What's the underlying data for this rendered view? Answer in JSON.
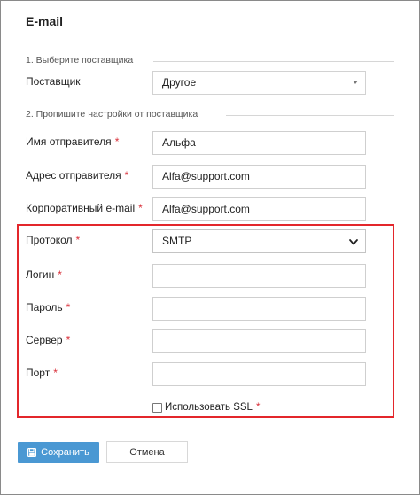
{
  "form": {
    "title": "E-mail",
    "section1": "1. Выберите поставщика",
    "section2": "2. Пропишите настройки от поставщика",
    "required_mark": "*"
  },
  "provider": {
    "label": "Поставщик",
    "value": "Другое"
  },
  "sender_name": {
    "label": "Имя отправителя",
    "value": "Альфа"
  },
  "sender_address": {
    "label": "Адрес отправителя",
    "value": "Alfa@support.com"
  },
  "corporate_email": {
    "label": "Корпоративный e-mail",
    "value": "Alfa@support.com"
  },
  "protocol": {
    "label": "Протокол",
    "value": "SMTP"
  },
  "login": {
    "label": "Логин",
    "value": ""
  },
  "password": {
    "label": "Пароль",
    "value": ""
  },
  "server": {
    "label": "Сервер",
    "value": ""
  },
  "port": {
    "label": "Порт",
    "value": ""
  },
  "ssl": {
    "label": "Использовать SSL",
    "checked": false
  },
  "actions": {
    "save_label": "Сохранить",
    "cancel_label": "Отмена"
  },
  "colors": {
    "accent": "#4a98d3",
    "required": "#d9303a",
    "highlight": "#e3262b"
  },
  "icons": {
    "save": "floppy-disk-icon",
    "provider_dropdown": "caret-down-icon",
    "protocol_dropdown": "chevron-down-icon"
  }
}
